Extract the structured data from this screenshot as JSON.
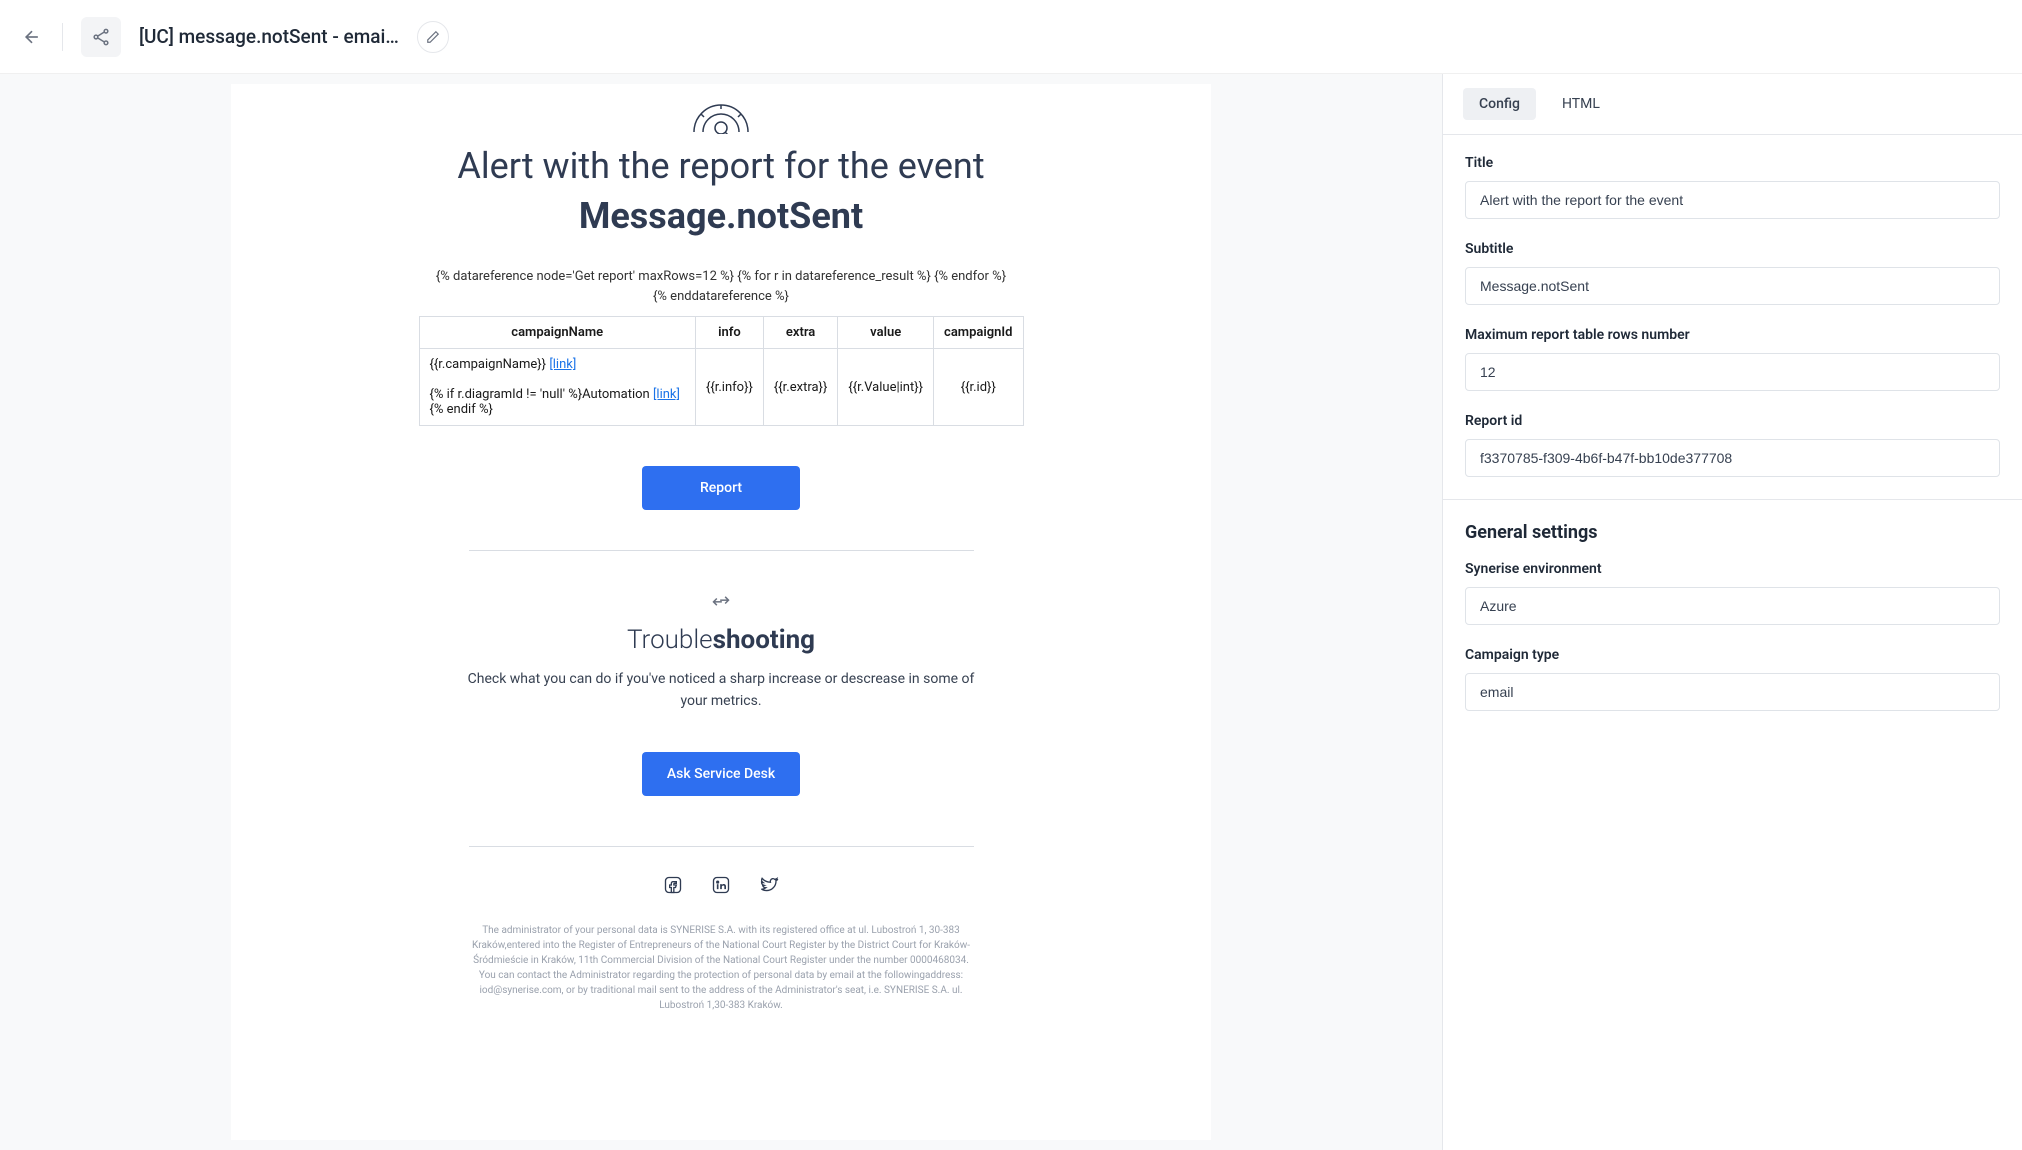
{
  "header": {
    "title": "[UC] message.notSent - email al..."
  },
  "email": {
    "title": "Alert with the report for the event",
    "subtitle": "Message.notSent",
    "template_code": "{% datareference node='Get report' maxRows=12 %} {% for r in datareference_result %} {% endfor %} {% enddatareference %}",
    "table": {
      "headers": {
        "c0": "campaignName",
        "c1": "info",
        "c2": "extra",
        "c3": "value",
        "c4": "campaignId"
      },
      "row": {
        "campaign_name": "{{r.campaignName}}",
        "link1": "[link]",
        "automation_line1": "{% if r.diagramId != 'null' %}Automation",
        "link2": "[link]",
        "automation_line2": "{% endif %}",
        "info": "{{r.info}}",
        "extra": "{{r.extra}}",
        "value": "{{r.Value|int}}",
        "id": "{{r.id}}"
      }
    },
    "report_button": "Report",
    "trouble_heading_light": "Trouble",
    "trouble_heading_bold": "shooting",
    "trouble_body": "Check what you can do if you've noticed a sharp increase or descrease in some of your metrics.",
    "ask_button": "Ask Service Desk",
    "footer_legal": "The administrator of your personal data is SYNERISE S.A. with its registered office at ul. Lubostroń 1, 30-383 Kraków,entered into the Register of Entrepreneurs of the National Court Register by the District Court for Kraków-Śródmieście in Kraków, 11th Commercial Division of the National Court Register under the number 0000468034. You can contact the Administrator regarding the protection of personal data by email at the followingaddress: iod@synerise.com, or by traditional mail sent to the address of the Administrator's seat, i.e. SYNERISE S.A. ul. Lubostroń 1,30-383 Kraków."
  },
  "panel": {
    "tabs": {
      "config": "Config",
      "html": "HTML"
    },
    "fields": {
      "title_label": "Title",
      "title_value": "Alert with the report for the event",
      "subtitle_label": "Subtitle",
      "subtitle_value": "Message.notSent",
      "maxrows_label": "Maximum report table rows number",
      "maxrows_value": "12",
      "reportid_label": "Report id",
      "reportid_value": "f3370785-f309-4b6f-b47f-bb10de377708"
    },
    "general_heading": "General settings",
    "general": {
      "env_label": "Synerise environment",
      "env_value": "Azure",
      "campaign_label": "Campaign type",
      "campaign_value": "email"
    }
  }
}
